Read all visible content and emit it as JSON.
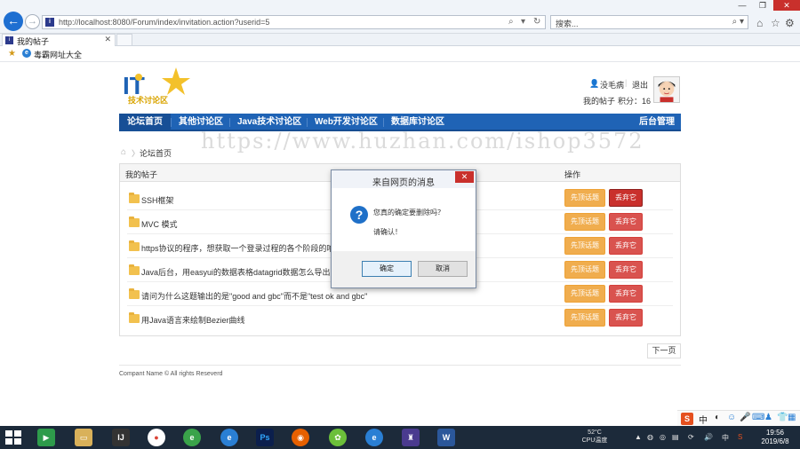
{
  "browser": {
    "url": "http://localhost:8080/Forum/index/invitation.action?userid=5",
    "search_placeholder": "搜索...",
    "tab_title": "我的帖子",
    "favorites_item": "毒霸网址大全"
  },
  "header": {
    "logo_text": "技术讨论区",
    "user_name": "没毛病",
    "logout": "退出",
    "my_posts": "我的帖子",
    "points": "积分：16"
  },
  "nav": {
    "items": [
      "论坛首页",
      "其他讨论区",
      "Java技术讨论区",
      "Web开发讨论区",
      "数据库讨论区"
    ],
    "admin": "后台管理"
  },
  "watermark": "https://www.huzhan.com/ishop3572",
  "breadcrumb": "论坛首页",
  "table": {
    "col_title": "我的帖子",
    "col_actions": "操作",
    "rows": [
      {
        "title": "SSH框架"
      },
      {
        "title": "MVC 模式"
      },
      {
        "title": "https协议的程序，想获取一个登录过程的各个阶段的响应时间"
      },
      {
        "title": "Java后台，用easyui的数据表格datagrid数据怎么导出到excel里"
      },
      {
        "title": "请问为什么这题输出的是\"good and gbc\"而不是\"test ok and gbc\""
      },
      {
        "title": "用Java语言来绘制Bezier曲线"
      }
    ],
    "btn_top": "先顶话题",
    "btn_drop": "丢弃它"
  },
  "pager": {
    "next": "下一页"
  },
  "footer": "Compant Name © All rights Reseverd",
  "dialog": {
    "title": "来自网页的消息",
    "message": "您真的确定要删除吗？",
    "sub": "请确认！",
    "ok": "确定",
    "cancel": "取消"
  },
  "ime": {
    "lang": "中"
  },
  "taskbar": {
    "temp_value": "52°C",
    "temp_label": "CPU温度",
    "tray_lang": "中",
    "time": "19:56",
    "date": "2019/6/8"
  },
  "colors": {
    "nav_bg": "#1f63b5",
    "btn_top": "#f0ad4e",
    "btn_drop": "#d9534f",
    "dialog_icon": "#1f70c8"
  }
}
